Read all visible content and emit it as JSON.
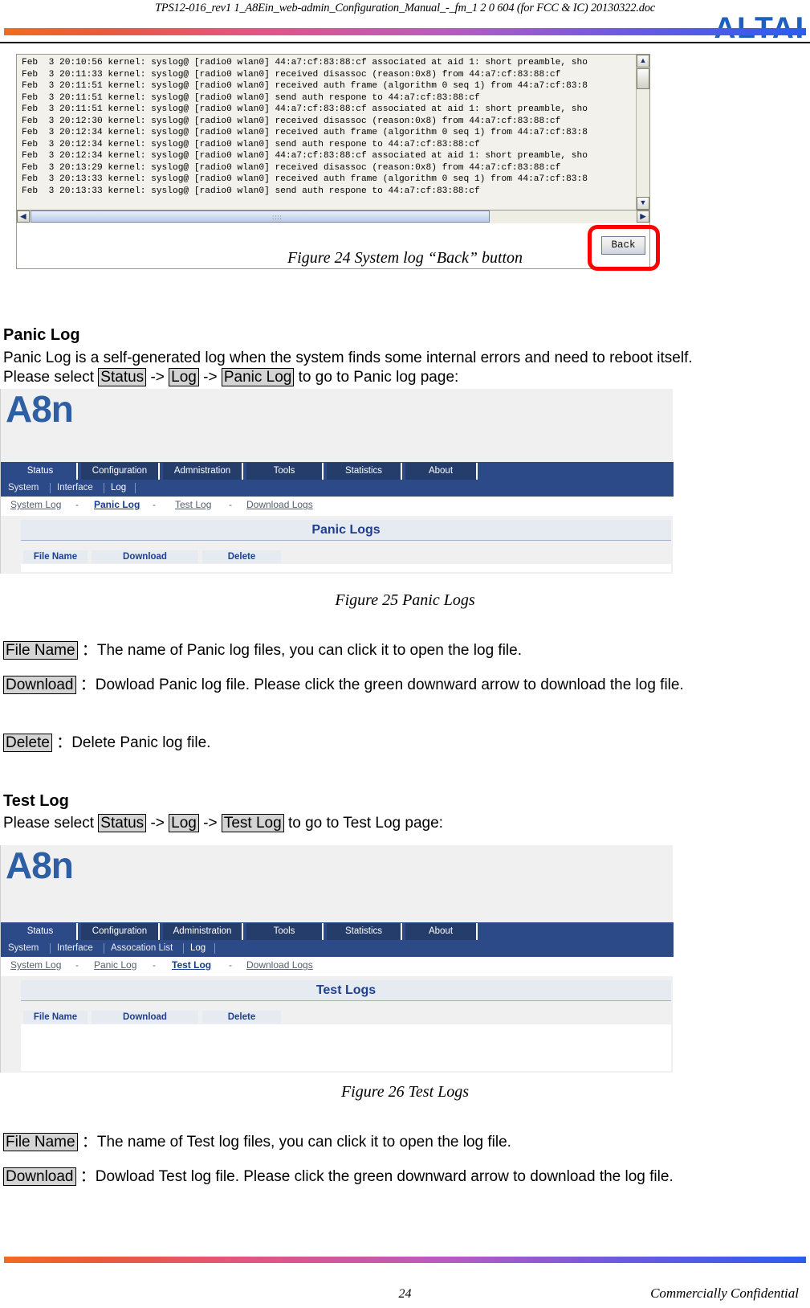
{
  "document": {
    "header_title": "TPS12-016_rev1 1_A8Ein_web-admin_Configuration_Manual_-_fm_1 2 0 604 (for FCC & IC) 20130322.doc",
    "brand_logo": "ALTAI",
    "page_number": "24",
    "confidentiality": "Commercially Confidential"
  },
  "syslog_figure": {
    "caption": "Figure 24 System log “Back” button",
    "lines": [
      "Feb  3 20:10:56 kernel: syslog@ [radio0 wlan0] 44:a7:cf:83:88:cf associated at aid 1: short preamble, sho",
      "Feb  3 20:11:33 kernel: syslog@ [radio0 wlan0] received disassoc (reason:0x8) from 44:a7:cf:83:88:cf",
      "Feb  3 20:11:51 kernel: syslog@ [radio0 wlan0] received auth frame (algorithm 0 seq 1) from 44:a7:cf:83:8",
      "Feb  3 20:11:51 kernel: syslog@ [radio0 wlan0] send auth respone to 44:a7:cf:83:88:cf",
      "Feb  3 20:11:51 kernel: syslog@ [radio0 wlan0] 44:a7:cf:83:88:cf associated at aid 1: short preamble, sho",
      "Feb  3 20:12:30 kernel: syslog@ [radio0 wlan0] received disassoc (reason:0x8) from 44:a7:cf:83:88:cf",
      "Feb  3 20:12:34 kernel: syslog@ [radio0 wlan0] received auth frame (algorithm 0 seq 1) from 44:a7:cf:83:8",
      "Feb  3 20:12:34 kernel: syslog@ [radio0 wlan0] send auth respone to 44:a7:cf:83:88:cf",
      "Feb  3 20:12:34 kernel: syslog@ [radio0 wlan0] 44:a7:cf:83:88:cf associated at aid 1: short preamble, sho",
      "Feb  3 20:13:29 kernel: syslog@ [radio0 wlan0] received disassoc (reason:0x8) from 44:a7:cf:83:88:cf",
      "Feb  3 20:13:33 kernel: syslog@ [radio0 wlan0] received auth frame (algorithm 0 seq 1) from 44:a7:cf:83:8",
      "Feb  3 20:13:33 kernel: syslog@ [radio0 wlan0] send auth respone to 44:a7:cf:83:88:cf"
    ],
    "back_button": "Back",
    "scroll_up": "▲",
    "scroll_down": "▼",
    "scroll_left": "◀",
    "scroll_right": "▶",
    "highlight_color": "#ff0000"
  },
  "panic_section": {
    "heading": "Panic Log",
    "intro_line1": "Panic Log is a self-generated log when the system finds some internal errors and need to reboot itself.",
    "intro_prefix": "Please select ",
    "kw_status": "Status",
    "arrow1": " -> ",
    "kw_log": "Log",
    "arrow2": " -> ",
    "kw_panic_log": "Panic Log",
    "intro_suffix": " to go to Panic log page:",
    "caption": "Figure 25 Panic Logs",
    "defs": [
      {
        "term": "File Name",
        "text": "：The name of Panic log files, you can click it to open the log file."
      },
      {
        "term": "Download",
        "text": "：Dowload Panic log file. Please click the green downward arrow to download the log file."
      },
      {
        "term": "Delete",
        "text": "：Delete Panic log file."
      }
    ]
  },
  "test_section": {
    "heading": "Test Log",
    "intro_prefix": "Please select ",
    "kw_status": "Status",
    "arrow1": " -> ",
    "kw_log": "Log",
    "arrow2": " -> ",
    "kw_test_log": "Test Log",
    "intro_suffix": " to go to Test Log page:",
    "caption": "Figure 26 Test Logs",
    "defs": [
      {
        "term": "File Name",
        "text": "：The name of Test log files, you can click it to open the log file."
      },
      {
        "term": "Download",
        "text": "：Dowload Test log file. Please click the green downward arrow to download the log file."
      }
    ]
  },
  "webui_panic": {
    "brand": "A8n",
    "tabs": [
      {
        "label": "Status",
        "active": true
      },
      {
        "label": "Configuration",
        "active": false
      },
      {
        "label": "Admnistration",
        "active": false
      },
      {
        "label": "Tools",
        "active": false
      },
      {
        "label": "Statistics",
        "active": false
      },
      {
        "label": "About",
        "active": false
      }
    ],
    "subnav": [
      {
        "label": "System",
        "active": false
      },
      {
        "label": "Interface",
        "active": false
      },
      {
        "label": "Log",
        "active": true
      }
    ],
    "crumbs": [
      {
        "label": "System Log",
        "active": false
      },
      {
        "label": "Panic Log",
        "active": true
      },
      {
        "label": "Test Log",
        "active": false
      },
      {
        "label": "Download Logs",
        "active": false
      }
    ],
    "crumb_separator": "-",
    "panel_title": "Panic Logs",
    "columns": [
      "File Name",
      "Download",
      "Delete"
    ]
  },
  "webui_test": {
    "brand": "A8n",
    "tabs": [
      {
        "label": "Status",
        "active": true
      },
      {
        "label": "Configuration",
        "active": false
      },
      {
        "label": "Administration",
        "active": false
      },
      {
        "label": "Tools",
        "active": false
      },
      {
        "label": "Statistics",
        "active": false
      },
      {
        "label": "About",
        "active": false
      }
    ],
    "subnav": [
      {
        "label": "System",
        "active": false
      },
      {
        "label": "Interface",
        "active": false
      },
      {
        "label": "Assocation List",
        "active": false
      },
      {
        "label": "Log",
        "active": true
      }
    ],
    "crumbs": [
      {
        "label": "System Log",
        "active": false
      },
      {
        "label": "Panic Log",
        "active": false
      },
      {
        "label": "Test Log",
        "active": true
      },
      {
        "label": "Download Logs",
        "active": false
      }
    ],
    "crumb_separator": "-",
    "panel_title": "Test Logs",
    "columns": [
      "File Name",
      "Download",
      "Delete"
    ]
  }
}
